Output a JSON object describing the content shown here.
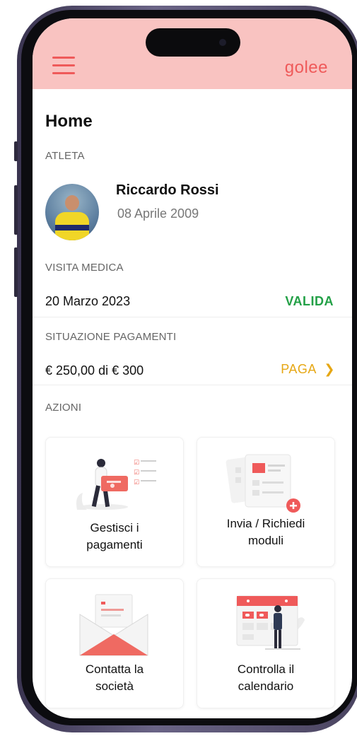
{
  "header": {
    "brand": "golee",
    "menu_icon": "hamburger-icon"
  },
  "page": {
    "title": "Home"
  },
  "athlete": {
    "section_label": "ATLETA",
    "name": "Riccardo Rossi",
    "birth_date": "08 Aprile 2009"
  },
  "medical": {
    "section_label": "VISITA MEDICA",
    "date": "20 Marzo 2023",
    "status": "VALIDA",
    "status_color": "#22a046"
  },
  "payments": {
    "section_label": "SITUAZIONE PAGAMENTI",
    "summary": "€ 250,00 di € 300",
    "action": "PAGA",
    "action_color": "#e6a714"
  },
  "actions": {
    "section_label": "AZIONI",
    "items": [
      {
        "label": "Gestisci i\npagamenti",
        "icon": "payments-illustration"
      },
      {
        "label": "Invia / Richiedi\nmoduli",
        "icon": "documents-illustration"
      },
      {
        "label": "Contatta la\nsocietà",
        "icon": "envelope-illustration"
      },
      {
        "label": "Controlla il\ncalendario",
        "icon": "calendar-illustration"
      }
    ]
  },
  "colors": {
    "accent": "#ef5a5a",
    "header_bg": "#f9c3c1"
  }
}
